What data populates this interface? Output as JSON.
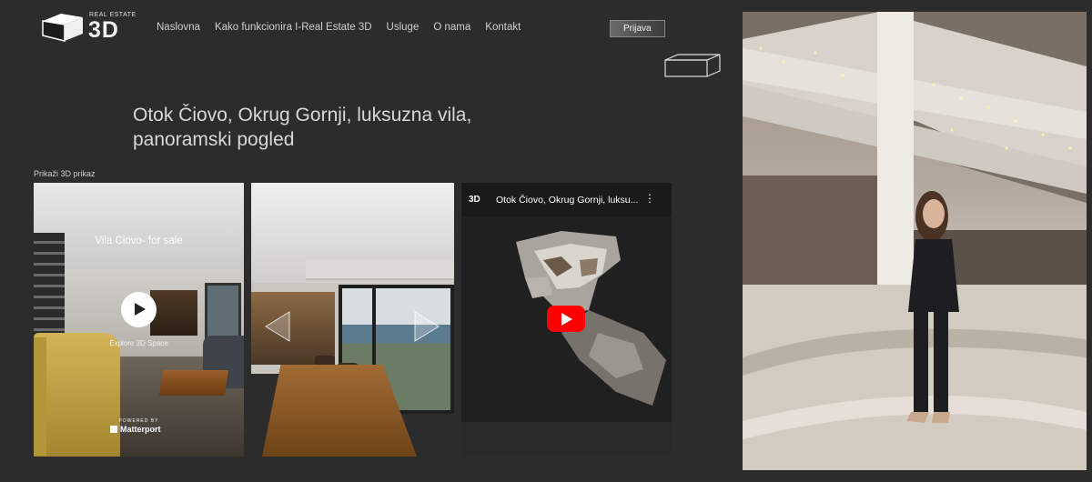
{
  "header": {
    "logo_small": "REAL ESTATE",
    "logo_big": "3D",
    "nav": [
      "Naslovna",
      "Kako funkcionira I-Real Estate 3D",
      "Usluge",
      "O nama",
      "Kontakt"
    ],
    "login_label": "Prijava"
  },
  "main": {
    "title": "Otok Čiovo, Okrug Gornji, luksuzna vila, panoramski pogled",
    "show_3d_label": "Prikaži 3D prikaz"
  },
  "tour_card": {
    "space_title": "Vila Ciovo- for sale",
    "explore_label": "Explore 3D Space",
    "powered_by": "POWERED BY",
    "brand": "Matterport"
  },
  "video_card": {
    "channel_badge": "3D",
    "title": "Otok Čiovo, Okrug Gornji, luksu...",
    "more_icon": "⋮"
  },
  "colors": {
    "background": "#2c2c2c",
    "youtube_red": "#ff0000"
  }
}
